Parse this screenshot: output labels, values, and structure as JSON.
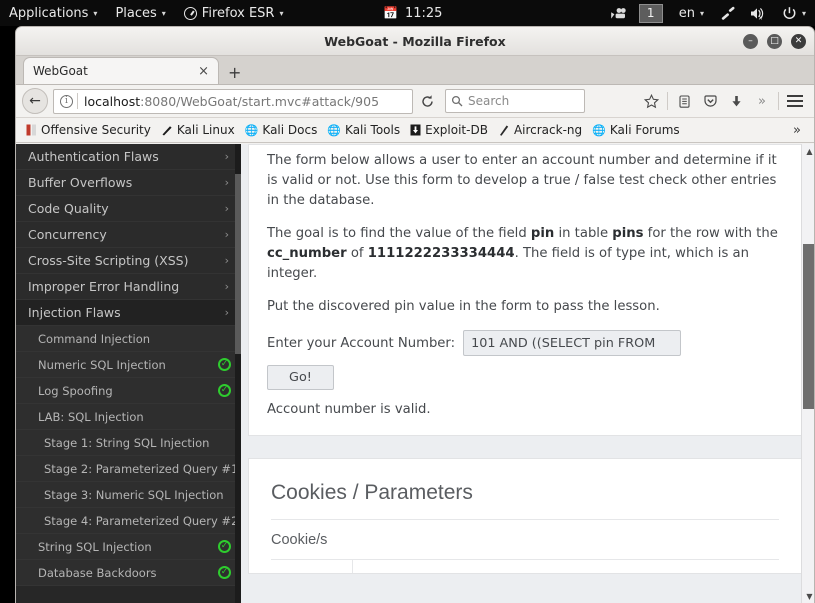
{
  "desktop_panel": {
    "applications_menu": "Applications",
    "places_menu": "Places",
    "firefox_menu": "Firefox ESR",
    "clock": "11:25",
    "calendar_icon": "calendar-icon",
    "firefox_icon": "firefox-icon",
    "screencast_icon": "screencast-icon",
    "workspace": "1",
    "keyboard_layout": "en",
    "network_icon": "network-icon",
    "volume_icon": "volume-muted-icon",
    "power_icon": "power-icon",
    "caret": "▾"
  },
  "window": {
    "title": "WebGoat - Mozilla Firefox",
    "minimize_label": "–",
    "maximize_label": "□",
    "close_label": "✕"
  },
  "tabs": {
    "items": [
      {
        "label": "WebGoat",
        "close": "×"
      }
    ],
    "new_tab_label": "+"
  },
  "navbar": {
    "back_label": "←",
    "identity_icon": "info-icon",
    "url_host": "localhost",
    "url_path": ":8080/WebGoat/start.mvc#attack/905",
    "reload_label": "↻",
    "search_placeholder": "Search",
    "search_icon": "search-icon",
    "bookmark_star_icon": "star-icon",
    "reader_icon": "reader-list-icon",
    "pocket_icon": "pocket-icon",
    "downloads_icon": "download-arrow-icon",
    "overflow_icon": "chevron-double-right-icon",
    "menu_icon": "hamburger-menu-icon"
  },
  "bookmarks": {
    "items": [
      {
        "label": "Offensive Security",
        "icon": "offsec-icon"
      },
      {
        "label": "Kali Linux",
        "icon": "kali-dragon-icon"
      },
      {
        "label": "Kali Docs",
        "icon": "globe-icon"
      },
      {
        "label": "Kali Tools",
        "icon": "globe-icon"
      },
      {
        "label": "Exploit-DB",
        "icon": "exploitdb-icon"
      },
      {
        "label": "Aircrack-ng",
        "icon": "aircrack-icon"
      },
      {
        "label": "Kali Forums",
        "icon": "globe-icon"
      }
    ],
    "overflow_label": "»"
  },
  "sidebar": {
    "categories": [
      {
        "label": "Authentication Flaws",
        "chevron": "›"
      },
      {
        "label": "Buffer Overflows",
        "chevron": "›"
      },
      {
        "label": "Code Quality",
        "chevron": "›"
      },
      {
        "label": "Concurrency",
        "chevron": "›"
      },
      {
        "label": "Cross-Site Scripting (XSS)",
        "chevron": "›"
      },
      {
        "label": "Improper Error Handling",
        "chevron": "›"
      },
      {
        "label": "Injection Flaws",
        "chevron": "›"
      }
    ],
    "lessons": [
      {
        "label": "Command Injection",
        "completed": false,
        "indent": false
      },
      {
        "label": "Numeric SQL Injection",
        "completed": true,
        "indent": false
      },
      {
        "label": "Log Spoofing",
        "completed": true,
        "indent": false
      },
      {
        "label": "LAB: SQL Injection",
        "completed": false,
        "indent": false
      },
      {
        "label": "Stage 1: String SQL Injection",
        "completed": false,
        "indent": true
      },
      {
        "label": "Stage 2: Parameterized Query #1",
        "completed": false,
        "indent": true
      },
      {
        "label": "Stage 3: Numeric SQL Injection",
        "completed": false,
        "indent": true
      },
      {
        "label": "Stage 4: Parameterized Query #2",
        "completed": false,
        "indent": true
      },
      {
        "label": "String SQL Injection",
        "completed": true,
        "indent": false
      },
      {
        "label": "Database Backdoors",
        "completed": true,
        "indent": false
      }
    ],
    "check_glyph": "✓"
  },
  "lesson": {
    "paragraph_1_a": "The form below allows a user to enter an account number and determine if it is valid or not. Use this form to develop a true / false test check other entries in the database.",
    "paragraph_2_a": "The goal is to find the value of the field ",
    "paragraph_2_b": "pin",
    "paragraph_2_c": " in table ",
    "paragraph_2_d": "pins",
    "paragraph_2_e": " for the row with the ",
    "paragraph_2_f": "cc_number",
    "paragraph_2_g": " of ",
    "paragraph_2_h": "1111222233334444",
    "paragraph_2_i": ". The field is of type int, which is an integer.",
    "paragraph_3": "Put the discovered pin value in the form to pass the lesson.",
    "account_label": "Enter your Account Number:",
    "account_value": "101 AND ((SELECT pin FROM",
    "go_label": "Go!",
    "result": "Account number is valid."
  },
  "cookies_section": {
    "title": "Cookies / Parameters",
    "subtitle": "Cookie/s"
  },
  "scrollbars": {
    "up_arrow": "▲",
    "down_arrow": "▼"
  },
  "colors": {
    "panel_bg": "#0b0b0b",
    "sidebar_bg": "#272727",
    "completed_check": "#2ecc2e",
    "content_bg": "#eceef1",
    "card_bg": "#ffffff"
  }
}
